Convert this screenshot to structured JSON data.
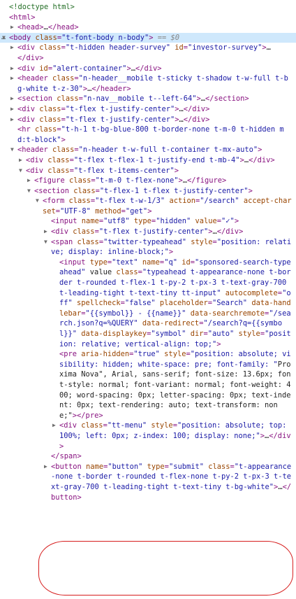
{
  "devtools": {
    "selected_marker": "==",
    "selected_var": "$0",
    "lines": [
      {
        "indent": 0,
        "tw": "",
        "text": "<!doctype html>",
        "cls": "cm"
      },
      {
        "indent": 0,
        "tw": "",
        "text": "<html>"
      },
      {
        "indent": 1,
        "tw": "▶",
        "text": "<head>…</head>"
      },
      {
        "indent": 0,
        "tw": "▼",
        "text": "<body class=\"t-font-body n-body\">",
        "selected": true
      },
      {
        "indent": 1,
        "tw": "▶",
        "text": "<div class=\"t-hidden header-survey\" id=\"investor-survey\">…"
      },
      {
        "indent": 1,
        "tw": "",
        "text": "</div>"
      },
      {
        "indent": 1,
        "tw": "▶",
        "text": "<div id=\"alert-container\">…</div>"
      },
      {
        "indent": 1,
        "tw": "▶",
        "text": "<header class=\"n-header__mobile t-sticky t-shadow t-w-full t-bg-white t-z-30\">…</header>"
      },
      {
        "indent": 1,
        "tw": "▶",
        "text": "<section class=\"n-nav__mobile t--left-64\">…</section>"
      },
      {
        "indent": 1,
        "tw": "▶",
        "text": "<div class=\"t-flex t-justify-center\">…</div>"
      },
      {
        "indent": 1,
        "tw": "▶",
        "text": "<div class=\"t-flex t-justify-center\">…</div>"
      },
      {
        "indent": 1,
        "tw": "",
        "text": "<hr class=\"t-h-1 t-bg-blue-800 t-border-none t-m-0 t-hidden md:t-block\">"
      },
      {
        "indent": 1,
        "tw": "▼",
        "text": "<header class=\"n-header t-w-full t-container t-mx-auto\">"
      },
      {
        "indent": 2,
        "tw": "▶",
        "text": "<div class=\"t-flex t-flex-1 t-justify-end t-mb-4\">…</div>"
      },
      {
        "indent": 2,
        "tw": "▼",
        "text": "<div class=\"t-flex t-items-center\">"
      },
      {
        "indent": 3,
        "tw": "▶",
        "text": "<figure class=\"t-m-0 t-flex-none\">…</figure>"
      },
      {
        "indent": 3,
        "tw": "▼",
        "text": "<section class=\"t-flex-1 t-flex t-justify-center\">"
      },
      {
        "indent": 4,
        "tw": "▼",
        "text": "<form class=\"t-flex t-w-1/3\" action=\"/search\" accept-charset=\"UTF-8\" method=\"get\">"
      },
      {
        "indent": 5,
        "tw": "",
        "text": "<input name=\"utf8\" type=\"hidden\" value=\"✓\">"
      },
      {
        "indent": 5,
        "tw": "▶",
        "text": "<div class=\"t-flex t-justify-center\">…</div>"
      },
      {
        "indent": 5,
        "tw": "▼",
        "text": "<span class=\"twitter-typeahead\" style=\"position: relative; display: inline-block;\">"
      },
      {
        "indent": 6,
        "tw": "",
        "text": "<input type=\"text\" name=\"q\" id=\"sponsored-search-typeahead\" value class=\"typeahead t-appearance-none t-border t-rounded t-flex-1 t-py-2 t-px-3 t-text-gray-700 t-leading-tight t-text-tiny tt-input\" autocomplete=\"off\" spellcheck=\"false\" placeholder=\"Search\" data-handlebar=\"{{symbol}} - {{name}}\" data-searchremote=\"/search.json?q=%QUERY\" data-redirect=\"/search?q={{symbol}}\" data-displaykey=\"symbol\" dir=\"auto\" style=\"position: relative; vertical-align: top;\">"
      },
      {
        "indent": 6,
        "tw": "",
        "text": "<pre aria-hidden=\"true\" style=\"position: absolute; visibility: hidden; white-space: pre; font-family: \"Proxima Nova\", Arial, sans-serif; font-size: 13.6px; font-style: normal; font-variant: normal; font-weight: 400; word-spacing: 0px; letter-spacing: 0px; text-indent: 0px; text-rendering: auto; text-transform: none;\"></pre>"
      },
      {
        "indent": 6,
        "tw": "▶",
        "text": "<div class=\"tt-menu\" style=\"position: absolute; top: 100%; left: 0px; z-index: 100; display: none;\">…</div>"
      },
      {
        "indent": 5,
        "tw": "",
        "text": "</span>"
      },
      {
        "indent": 5,
        "tw": "▶",
        "text": "<button name=\"button\" type=\"submit\" class=\"t-appearance-none t-border t-rounded t-flex-none t-py-2 t-px-3 t-text-gray-700 t-leading-tight t-text-tiny t-bg-white\">…</button>"
      }
    ]
  }
}
